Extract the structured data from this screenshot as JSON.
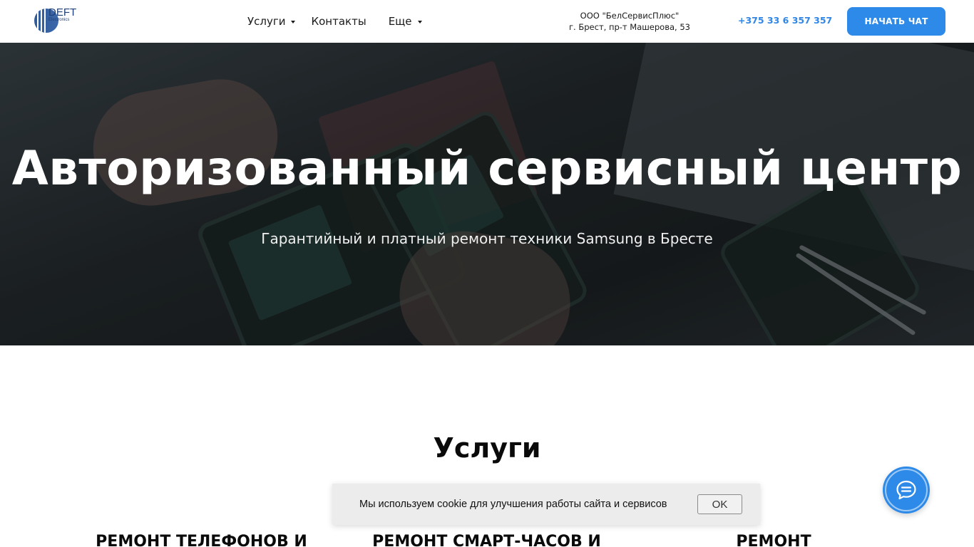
{
  "header": {
    "logo": {
      "text": "DEFT",
      "sub": "Electronics"
    },
    "nav": [
      {
        "label": "Услуги",
        "has_dropdown": true
      },
      {
        "label": "Контакты",
        "has_dropdown": false
      },
      {
        "label": "Еще",
        "has_dropdown": true
      }
    ],
    "company": {
      "name": "ООО \"БелСервисПлюс\"",
      "address": "г. Брест, пр-т Машерова, 53"
    },
    "phone": "+375 33 6 357 357",
    "chat_button": "НАЧАТЬ ЧАТ"
  },
  "hero": {
    "title": "Авторизованный сервисный центр",
    "subtitle": "Гарантийный и платный ремонт техники Samsung в Бресте"
  },
  "services": {
    "title": "Услуги",
    "cards": [
      {
        "title": "РЕМОНТ ТЕЛЕФОНОВ И"
      },
      {
        "title": "РЕМОНТ СМАРТ-ЧАСОВ И"
      },
      {
        "title": "РЕМОНТ"
      }
    ]
  },
  "cookie_banner": {
    "text": "Мы используем cookie для улучшения работы сайта и сервисов",
    "ok_label": "OK"
  },
  "chat_widget": {
    "icon": "chat-bubble-icon"
  },
  "colors": {
    "accent": "#2d8ae8",
    "phone": "#2f86e6",
    "logo": "#1f3f76"
  }
}
